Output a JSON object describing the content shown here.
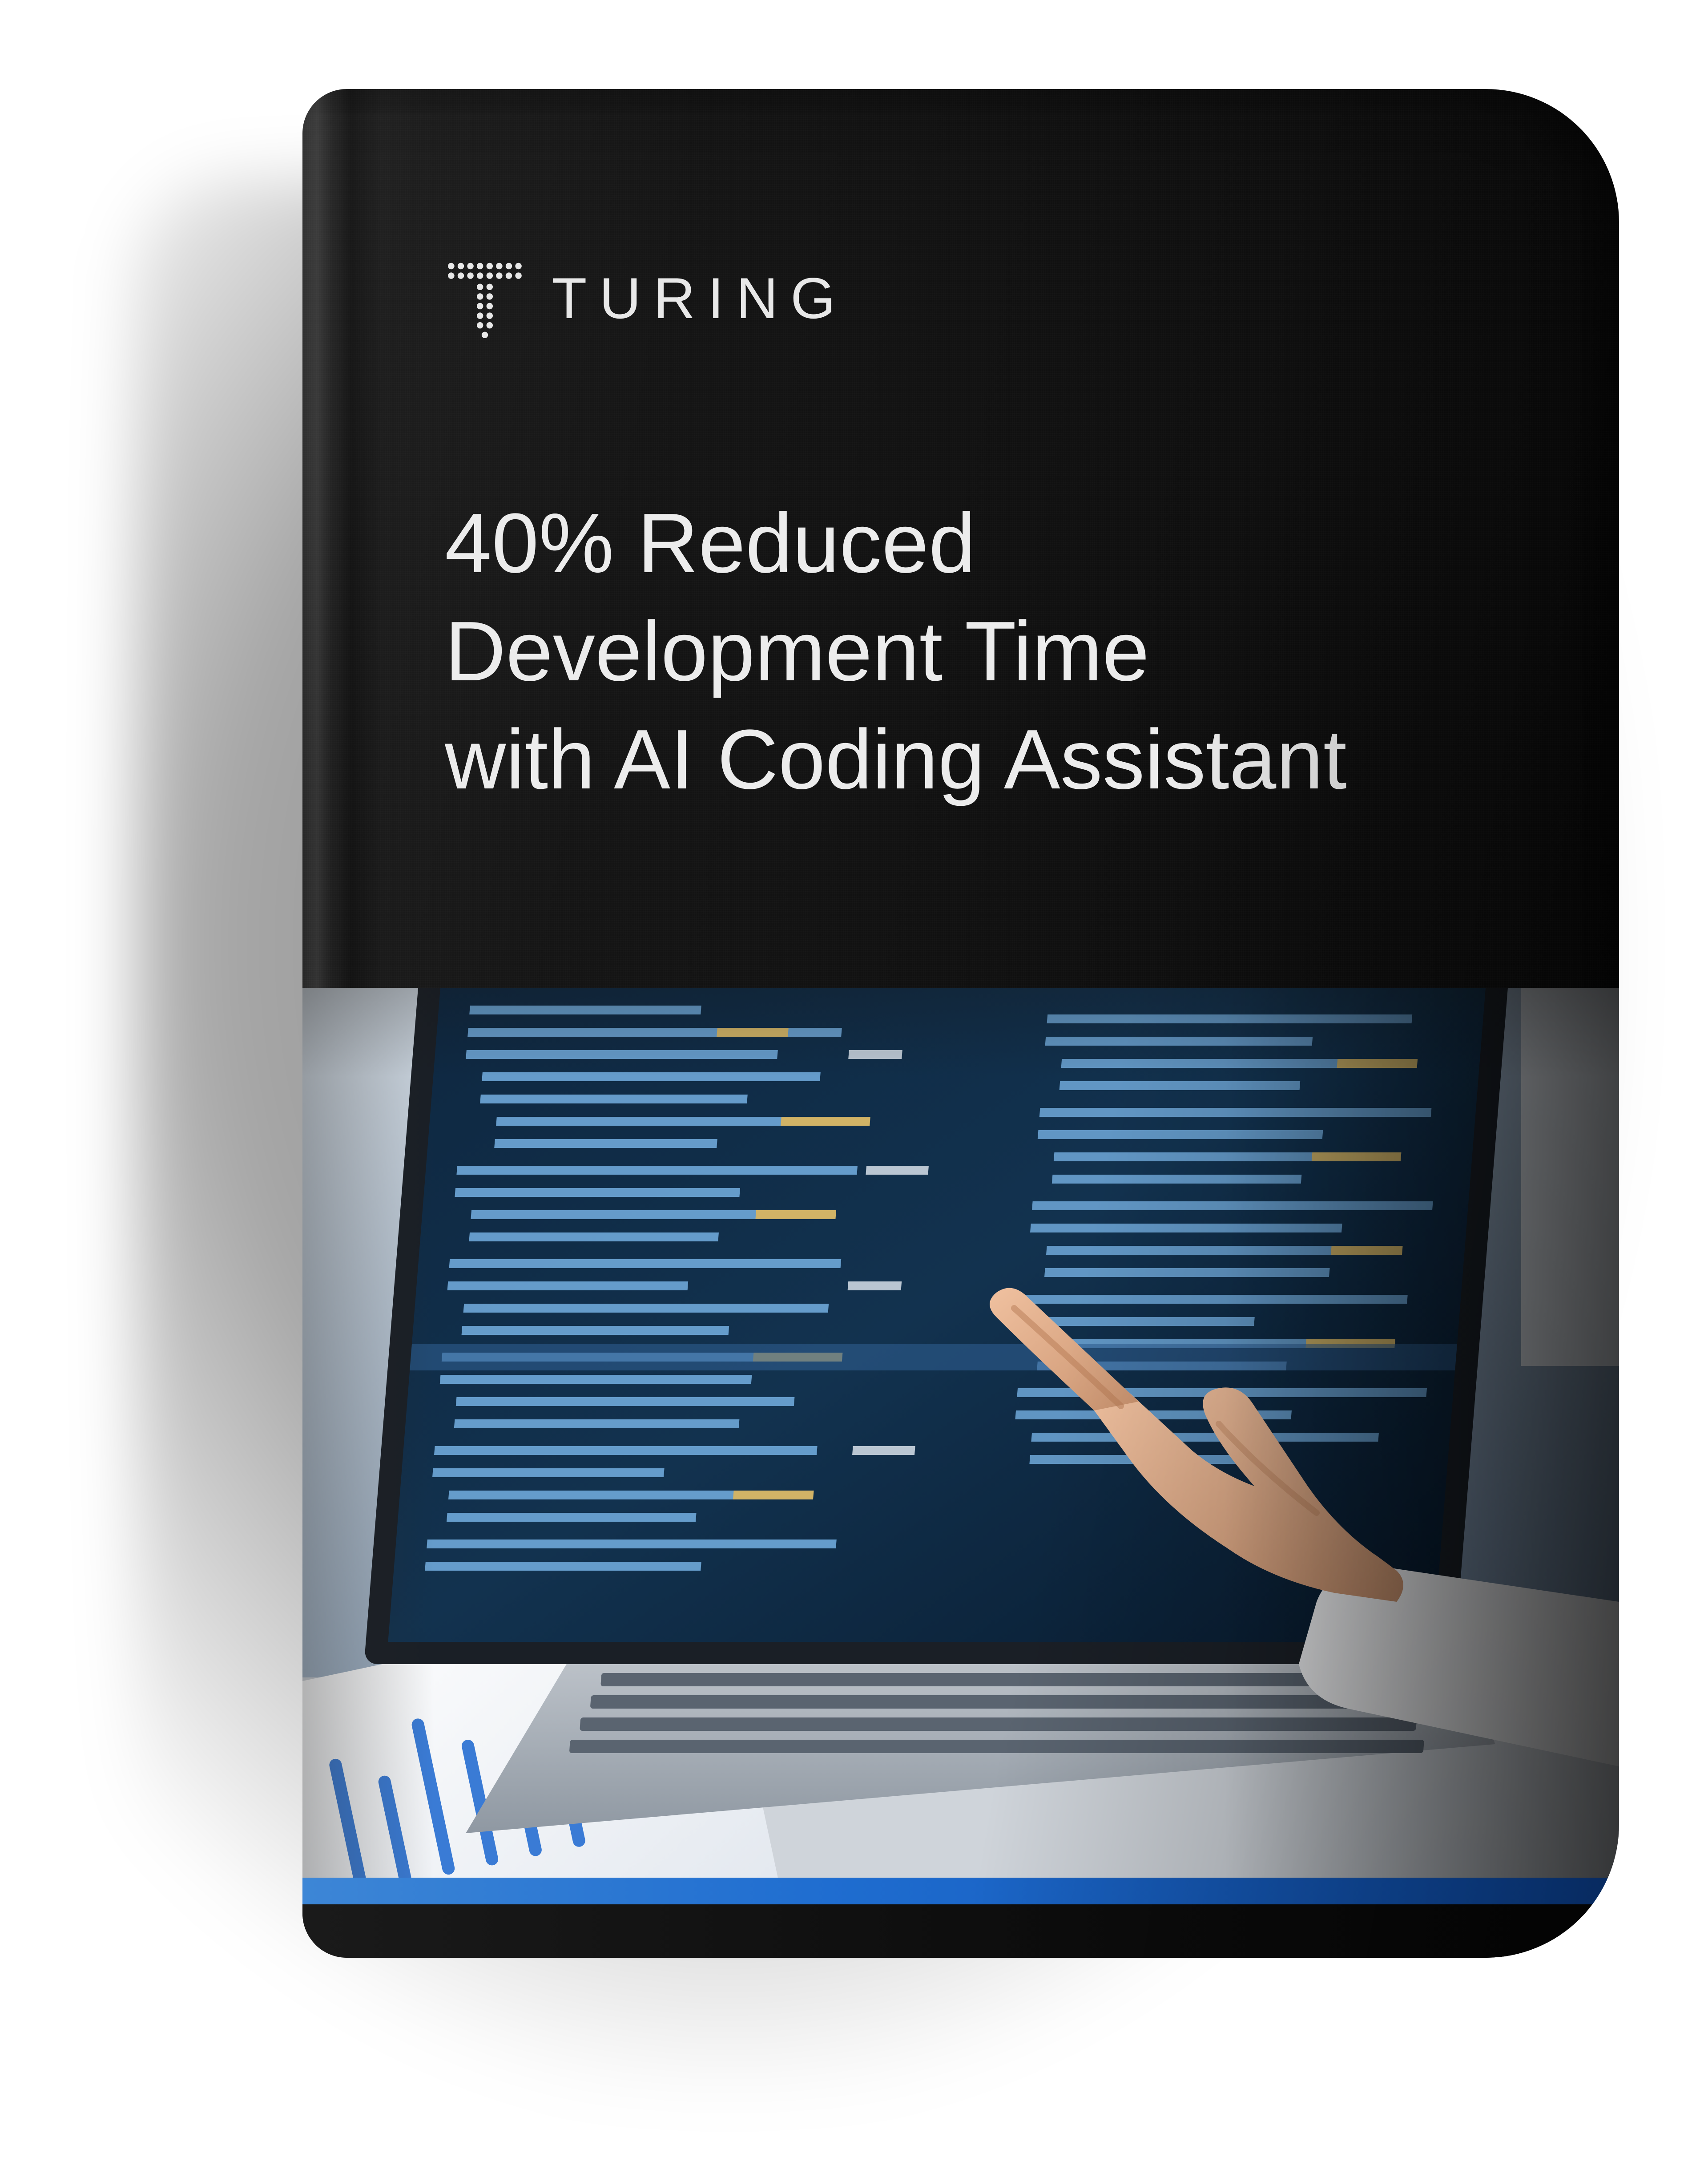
{
  "brand": {
    "name": "TURING"
  },
  "cover": {
    "title_line1": "40% Reduced",
    "title_line2": "Development Time",
    "title_line3": "with AI Coding Assistant",
    "accent_color": "#1f6dd0"
  }
}
